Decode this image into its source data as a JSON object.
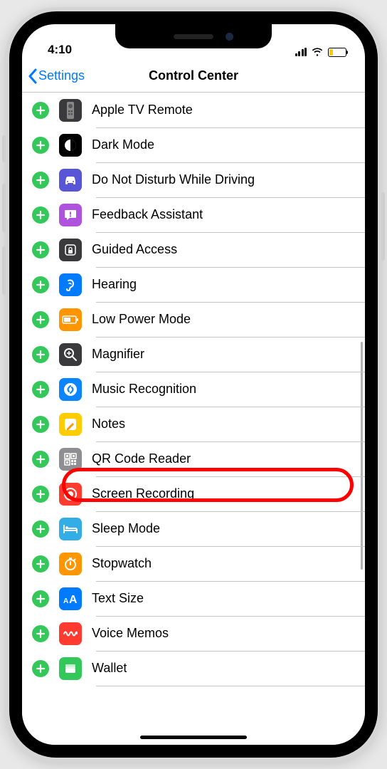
{
  "status": {
    "time": "4:10"
  },
  "nav": {
    "back_label": "Settings",
    "title": "Control Center"
  },
  "colors": {
    "accent": "#007aff",
    "add_green": "#34c759",
    "highlight": "#ff0000"
  },
  "highlighted_item": "Screen Recording",
  "items": [
    {
      "label": "Apple TV Remote",
      "icon": "apple-tv-remote-icon",
      "bg": "#3a3a3c"
    },
    {
      "label": "Dark Mode",
      "icon": "dark-mode-icon",
      "bg": "#000000"
    },
    {
      "label": "Do Not Disturb While Driving",
      "icon": "car-icon",
      "bg": "#5856d6"
    },
    {
      "label": "Feedback Assistant",
      "icon": "feedback-icon",
      "bg": "#af52de"
    },
    {
      "label": "Guided Access",
      "icon": "lock-square-icon",
      "bg": "#3a3a3c"
    },
    {
      "label": "Hearing",
      "icon": "ear-icon",
      "bg": "#007aff"
    },
    {
      "label": "Low Power Mode",
      "icon": "battery-icon",
      "bg": "#ff9500"
    },
    {
      "label": "Magnifier",
      "icon": "magnifier-icon",
      "bg": "#3a3a3c"
    },
    {
      "label": "Music Recognition",
      "icon": "shazam-icon",
      "bg": "#0a84ff"
    },
    {
      "label": "Notes",
      "icon": "notes-icon",
      "bg": "#ffcc00"
    },
    {
      "label": "QR Code Reader",
      "icon": "qr-icon",
      "bg": "#8e8e93"
    },
    {
      "label": "Screen Recording",
      "icon": "record-icon",
      "bg": "#ff3b30"
    },
    {
      "label": "Sleep Mode",
      "icon": "bed-icon",
      "bg": "#32ade6"
    },
    {
      "label": "Stopwatch",
      "icon": "stopwatch-icon",
      "bg": "#ff9500"
    },
    {
      "label": "Text Size",
      "icon": "text-size-icon",
      "bg": "#007aff"
    },
    {
      "label": "Voice Memos",
      "icon": "voice-memos-icon",
      "bg": "#ff3b30"
    },
    {
      "label": "Wallet",
      "icon": "wallet-icon",
      "bg": "#34c759"
    }
  ]
}
